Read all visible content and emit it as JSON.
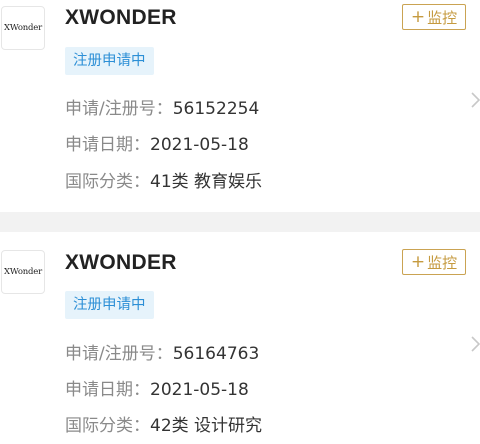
{
  "records": [
    {
      "logo_text": "XWonder",
      "name": "XWONDER",
      "status": "注册申请中",
      "monitor_label": "监控",
      "reg_no_label": "申请/注册号：",
      "reg_no": "56152254",
      "date_label": "申请日期：",
      "date": "2021-05-18",
      "class_label": "国际分类：",
      "class": "41类 教育娱乐"
    },
    {
      "logo_text": "XWonder",
      "name": "XWONDER",
      "status": "注册申请中",
      "monitor_label": "监控",
      "reg_no_label": "申请/注册号：",
      "reg_no": "56164763",
      "date_label": "申请日期：",
      "date": "2021-05-18",
      "class_label": "国际分类：",
      "class": "42类 设计研究"
    }
  ]
}
